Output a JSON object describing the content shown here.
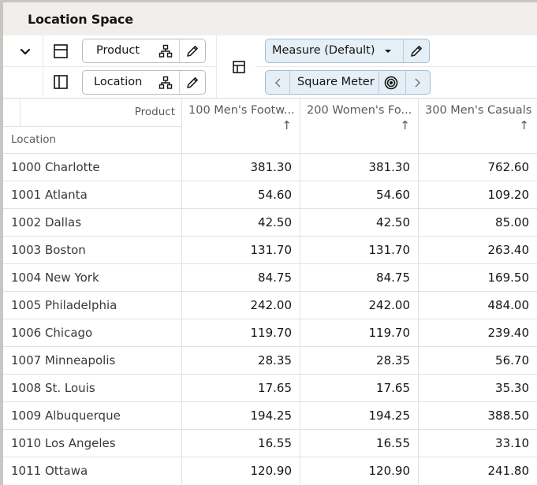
{
  "window": {
    "title": "Location Space"
  },
  "toolbar": {
    "collapse_icon": "chevron-down-icon",
    "rows_layout_icon": "layout-rows-icon",
    "columns_layout_icon": "layout-columns-icon",
    "pivot_icon": "pivot-layout-icon",
    "product_dimension": {
      "label": "Product",
      "hierarchy_icon": "hierarchy-icon",
      "edit_icon": "pencil-icon"
    },
    "location_dimension": {
      "label": "Location",
      "hierarchy_icon": "hierarchy-icon",
      "edit_icon": "pencil-icon"
    },
    "measure_selector": {
      "label": "Measure (Default)",
      "dropdown_icon": "caret-down-icon",
      "edit_icon": "pencil-icon"
    },
    "measure_nav": {
      "label": "Square Meter",
      "prev_icon": "chevron-left-icon",
      "next_icon": "chevron-right-icon",
      "target_icon": "target-icon"
    }
  },
  "grid": {
    "corner": {
      "column_axis_label": "Product",
      "row_axis_label": "Location"
    },
    "columns": [
      {
        "label": "100 Men's Footw...",
        "sort_icon": "arrow-up-icon"
      },
      {
        "label": "200 Women's Fo...",
        "sort_icon": "arrow-up-icon"
      },
      {
        "label": "300 Men's Casuals",
        "sort_icon": "arrow-up-icon"
      }
    ],
    "rows": [
      {
        "location": "1000 Charlotte",
        "values": [
          "381.30",
          "381.30",
          "762.60"
        ]
      },
      {
        "location": "1001 Atlanta",
        "values": [
          "54.60",
          "54.60",
          "109.20"
        ]
      },
      {
        "location": "1002 Dallas",
        "values": [
          "42.50",
          "42.50",
          "85.00"
        ]
      },
      {
        "location": "1003 Boston",
        "values": [
          "131.70",
          "131.70",
          "263.40"
        ]
      },
      {
        "location": "1004 New York",
        "values": [
          "84.75",
          "84.75",
          "169.50"
        ]
      },
      {
        "location": "1005 Philadelphia",
        "values": [
          "242.00",
          "242.00",
          "484.00"
        ]
      },
      {
        "location": "1006 Chicago",
        "values": [
          "119.70",
          "119.70",
          "239.40"
        ]
      },
      {
        "location": "1007 Minneapolis",
        "values": [
          "28.35",
          "28.35",
          "56.70"
        ]
      },
      {
        "location": "1008 St. Louis",
        "values": [
          "17.65",
          "17.65",
          "35.30"
        ]
      },
      {
        "location": "1009 Albuquerque",
        "values": [
          "194.25",
          "194.25",
          "388.50"
        ]
      },
      {
        "location": "1010 Los Angeles",
        "values": [
          "16.55",
          "16.55",
          "33.10"
        ]
      },
      {
        "location": "1011 Ottawa",
        "values": [
          "120.90",
          "120.90",
          "241.80"
        ]
      }
    ]
  }
}
